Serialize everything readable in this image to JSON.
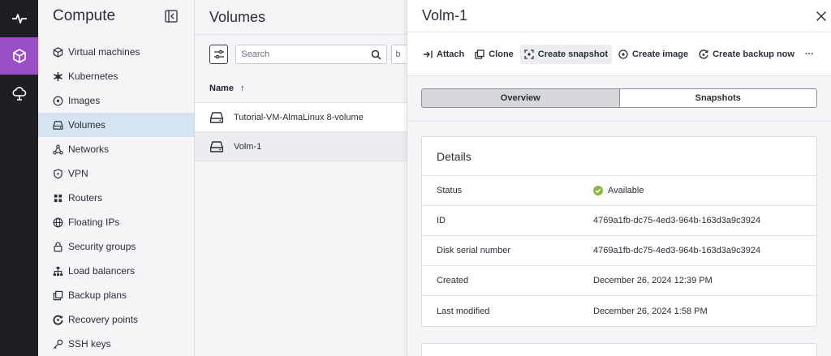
{
  "rail": {
    "items": [
      {
        "icon": "activity-icon",
        "active": false
      },
      {
        "icon": "cube-icon",
        "active": true
      },
      {
        "icon": "cloud-icon",
        "active": false
      }
    ]
  },
  "sidebar": {
    "title": "Compute",
    "items": [
      {
        "label": "Virtual machines",
        "icon": "box-icon"
      },
      {
        "label": "Kubernetes",
        "icon": "kubernetes-icon"
      },
      {
        "label": "Images",
        "icon": "disc-icon"
      },
      {
        "label": "Volumes",
        "icon": "hard-drive-icon",
        "active": true
      },
      {
        "label": "Networks",
        "icon": "network-icon"
      },
      {
        "label": "VPN",
        "icon": "shield-icon"
      },
      {
        "label": "Routers",
        "icon": "router-icon"
      },
      {
        "label": "Floating IPs",
        "icon": "globe-icon"
      },
      {
        "label": "Security groups",
        "icon": "lock-icon"
      },
      {
        "label": "Load balancers",
        "icon": "sitemap-icon"
      },
      {
        "label": "Backup plans",
        "icon": "copy-icon"
      },
      {
        "label": "Recovery points",
        "icon": "history-icon"
      },
      {
        "label": "SSH keys",
        "icon": "key-icon"
      }
    ]
  },
  "list": {
    "title": "Volumes",
    "search_placeholder": "Search",
    "extra_label": "b",
    "column_name": "Name",
    "sort_arrow": "↑",
    "rows": [
      {
        "name": "Tutorial-VM-AlmaLinux 8-volume",
        "selected": false
      },
      {
        "name": "Volm-1",
        "selected": true
      }
    ]
  },
  "detail": {
    "title": "Volm-1",
    "actions": [
      {
        "label": "Attach",
        "icon": "attach-icon"
      },
      {
        "label": "Clone",
        "icon": "clone-icon"
      },
      {
        "label": "Create snapshot",
        "icon": "snapshot-icon"
      },
      {
        "label": "Create image",
        "icon": "image-icon"
      },
      {
        "label": "Create backup now",
        "icon": "backup-icon"
      }
    ],
    "more": "···",
    "tabs": [
      "Overview",
      "Snapshots"
    ],
    "card_title": "Details",
    "fields": [
      {
        "key": "Status",
        "value": "Available",
        "status": true
      },
      {
        "key": "ID",
        "value": "4769a1fb-dc75-4ed3-964b-163d3a9c3924"
      },
      {
        "key": "Disk serial number",
        "value": "4769a1fb-dc75-4ed3-964b-163d3a9c3924"
      },
      {
        "key": "Created",
        "value": "December 26, 2024 12:39 PM"
      },
      {
        "key": "Last modified",
        "value": "December 26, 2024 1:58 PM"
      }
    ]
  },
  "colors": {
    "rail_bg": "#1f1f23",
    "rail_active": "#9b4fc7",
    "sidebar_active": "#d6e3f1",
    "status_ok": "#8bb84a"
  }
}
